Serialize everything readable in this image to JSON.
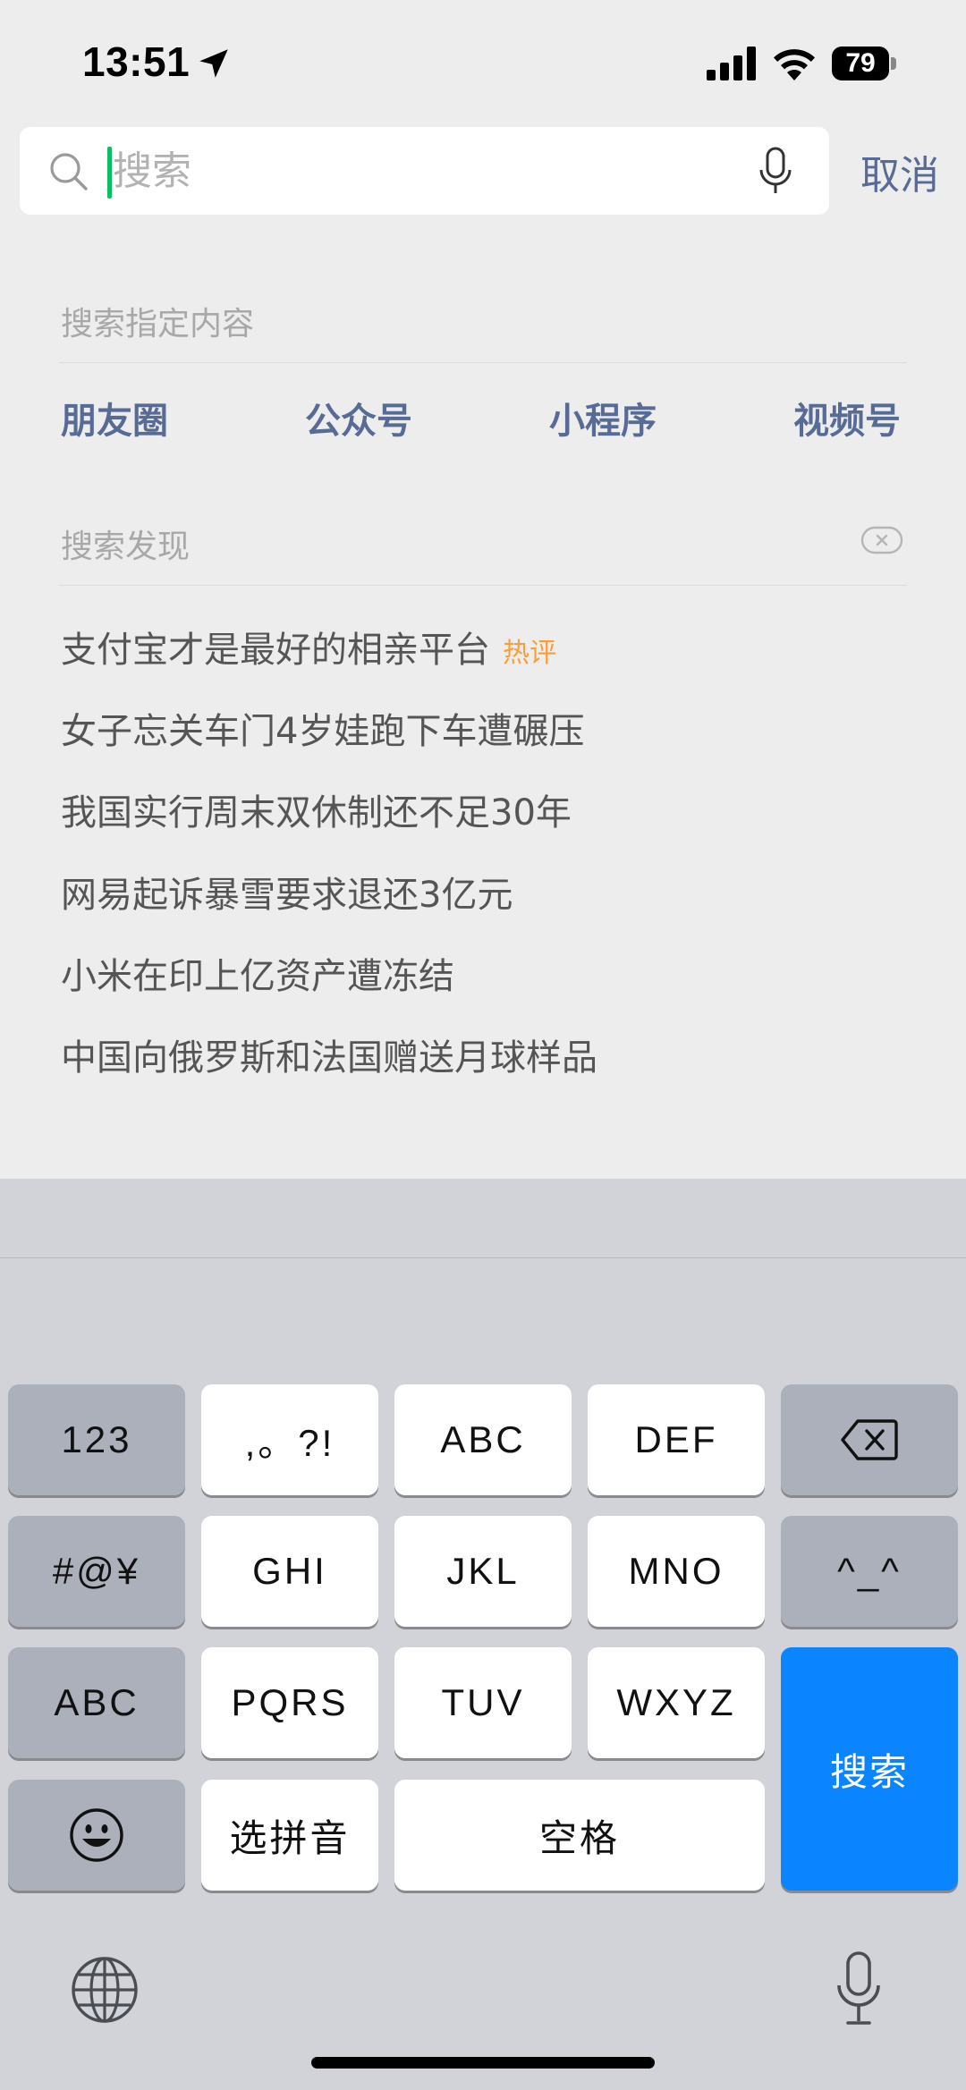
{
  "status_bar": {
    "time": "13:51",
    "battery": "79"
  },
  "search": {
    "placeholder": "搜索",
    "value": "",
    "cancel_label": "取消"
  },
  "specified": {
    "title": "搜索指定内容",
    "categories": [
      "朋友圈",
      "公众号",
      "小程序",
      "视频号"
    ]
  },
  "discover": {
    "title": "搜索发现",
    "items": [
      {
        "text": "支付宝才是最好的相亲平台",
        "tag": "热评"
      },
      {
        "text": "女子忘关车门4岁娃跑下车遭碾压"
      },
      {
        "text": "我国实行周末双休制还不足30年"
      },
      {
        "text": "网易起诉暴雪要求退还3亿元"
      },
      {
        "text": "小米在印上亿资产遭冻结"
      },
      {
        "text": "中国向俄罗斯和法国赠送月球样品"
      }
    ]
  },
  "keyboard": {
    "row1": [
      "123",
      ",。?!",
      "ABC",
      "DEF"
    ],
    "row2": [
      "#@¥",
      "GHI",
      "JKL",
      "MNO",
      "^_^"
    ],
    "row3": [
      "ABC",
      "PQRS",
      "TUV",
      "WXYZ"
    ],
    "row4": [
      "选拼音",
      "空格"
    ],
    "search_label": "搜索"
  },
  "colors": {
    "accent_link": "#576b95",
    "caret": "#07c160",
    "hot_tag": "#fa9d3b",
    "search_key": "#0a84ff"
  }
}
